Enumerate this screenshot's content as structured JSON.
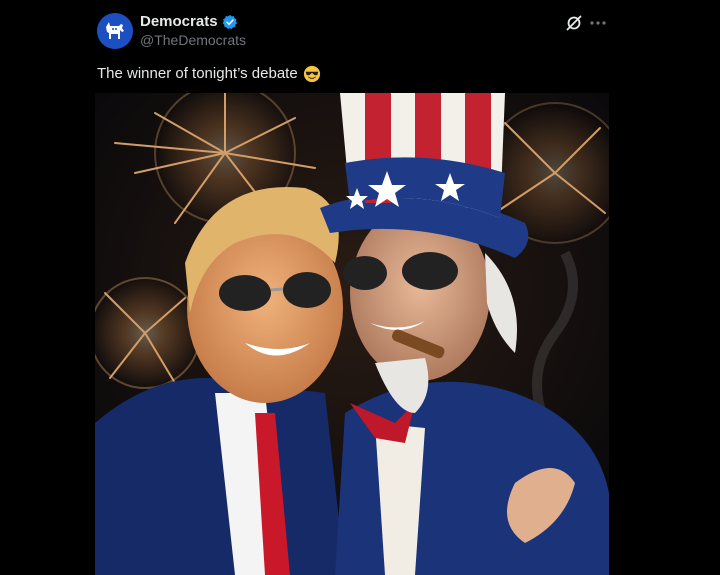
{
  "author": {
    "display_name": "Democrats",
    "handle": "@TheDemocrats",
    "verified": true,
    "avatar_icon": "donkey-logo-icon",
    "avatar_color": "#1b4fc2"
  },
  "actions": {
    "grok_icon": "grok-icon",
    "more_icon": "more-options-icon"
  },
  "post": {
    "text": "The winner of tonight’s debate",
    "emoji": "sunglasses-emoji"
  },
  "media": {
    "type": "photo"
  },
  "colors": {
    "background": "#000000",
    "primary_text": "#e7e9ea",
    "secondary_text": "#71767b",
    "verified_blue": "#1d9bf0"
  }
}
